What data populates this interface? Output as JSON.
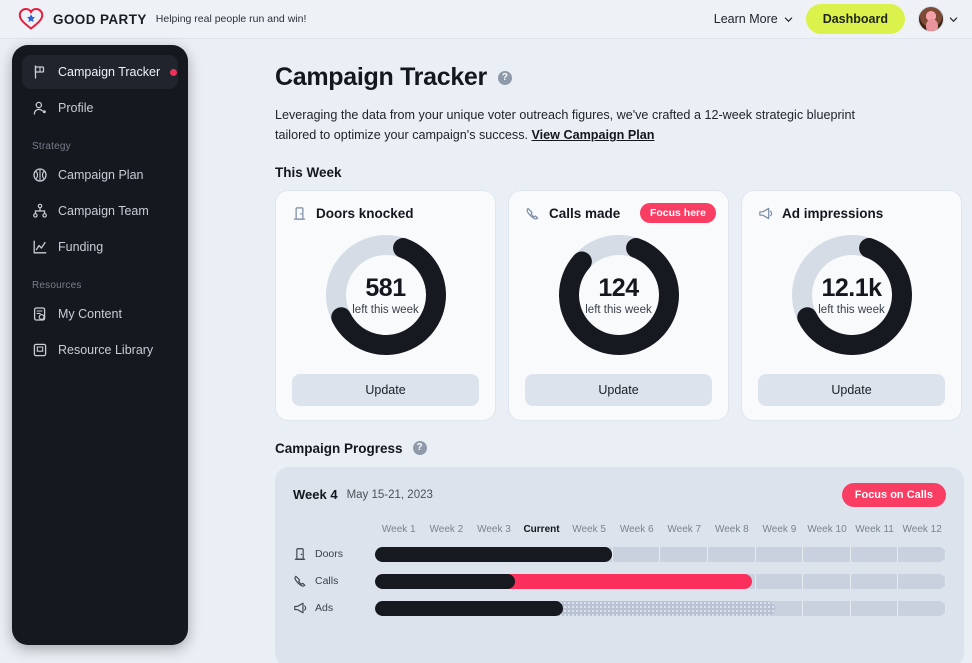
{
  "topbar": {
    "brand_name": "GOOD PARTY",
    "tagline": "Helping real people run and win!",
    "learn_more": "Learn More",
    "dashboard_button": "Dashboard"
  },
  "sidebar": {
    "items": [
      {
        "label": "Campaign Tracker",
        "icon": "flag-icon",
        "active": true,
        "dot": true
      },
      {
        "label": "Profile",
        "icon": "user-icon",
        "active": false,
        "dot": false
      }
    ],
    "sections": [
      {
        "title": "Strategy",
        "items": [
          {
            "label": "Campaign Plan",
            "icon": "brain-icon"
          },
          {
            "label": "Campaign Team",
            "icon": "team-icon"
          },
          {
            "label": "Funding",
            "icon": "chart-line-icon"
          }
        ]
      },
      {
        "title": "Resources",
        "items": [
          {
            "label": "My Content",
            "icon": "document-shield-icon"
          },
          {
            "label": "Resource Library",
            "icon": "book-icon"
          }
        ]
      }
    ]
  },
  "page": {
    "title": "Campaign Tracker",
    "help_glyph": "?",
    "description": "Leveraging the data from your unique voter outreach figures, we've crafted a 12-week strategic blueprint tailored to optimize your campaign's success.",
    "plan_link": "View Campaign Plan",
    "this_week_heading": "This Week"
  },
  "cards": [
    {
      "title": "Doors knocked",
      "icon": "door-icon",
      "value": "581",
      "sub": "left this week",
      "button": "Update",
      "badge": null,
      "percent": 62
    },
    {
      "title": "Calls made",
      "icon": "phone-icon",
      "value": "124",
      "sub": "left this week",
      "button": "Update",
      "badge": "Focus here",
      "percent": 81
    },
    {
      "title": "Ad impressions",
      "icon": "megaphone-icon",
      "value": "12.1k",
      "sub": "left this week",
      "button": "Update",
      "badge": null,
      "percent": 62
    }
  ],
  "progress": {
    "heading": "Campaign Progress",
    "help_glyph": "?",
    "week_number": "Week 4",
    "week_range": "May 15-21, 2023",
    "focus_button": "Focus on Calls",
    "week_labels": [
      "Week 1",
      "Week 2",
      "Week 3",
      "Current",
      "Week 5",
      "Week 6",
      "Week 7",
      "Week 8",
      "Week 9",
      "Week 10",
      "Week 11",
      "Week 12"
    ],
    "current_index": 3,
    "rows": [
      {
        "name": "Doors",
        "icon": "door-icon",
        "dark_pct": 41.5,
        "pink_pct": 0,
        "dots_pct": 0
      },
      {
        "name": "Calls",
        "icon": "phone-icon",
        "dark_pct": 24.5,
        "pink_pct": 41.5,
        "dots_pct": 0
      },
      {
        "name": "Ads",
        "icon": "megaphone-icon",
        "dark_pct": 33.0,
        "pink_pct": 0,
        "dots_pct": 37.0
      }
    ]
  },
  "colors": {
    "accent_pink": "#f93d63",
    "accent_lime": "#dcf24c",
    "dark": "#16191f",
    "panel": "#dde3ec",
    "page_bg": "#eaeff5"
  },
  "chart_data": [
    {
      "type": "pie",
      "title": "Doors knocked",
      "labels": [
        "completed",
        "remaining"
      ],
      "values": [
        62,
        38
      ],
      "center_value": "581",
      "center_label": "left this week"
    },
    {
      "type": "pie",
      "title": "Calls made",
      "labels": [
        "completed",
        "remaining"
      ],
      "values": [
        81,
        19
      ],
      "center_value": "124",
      "center_label": "left this week"
    },
    {
      "type": "pie",
      "title": "Ad impressions",
      "labels": [
        "completed",
        "remaining"
      ],
      "values": [
        62,
        38
      ],
      "center_value": "12.1k",
      "center_label": "left this week"
    },
    {
      "type": "bar",
      "title": "Campaign Progress",
      "categories": [
        "Week 1",
        "Week 2",
        "Week 3",
        "Current",
        "Week 5",
        "Week 6",
        "Week 7",
        "Week 8",
        "Week 9",
        "Week 10",
        "Week 11",
        "Week 12"
      ],
      "series": [
        {
          "name": "Doors",
          "values": [
            100,
            100,
            100,
            100,
            100,
            0,
            0,
            0,
            0,
            0,
            0,
            0
          ]
        },
        {
          "name": "Calls",
          "values": [
            100,
            100,
            100,
            45,
            100,
            0,
            0,
            0,
            0,
            0,
            0,
            0
          ]
        },
        {
          "name": "Ads",
          "values": [
            100,
            100,
            100,
            100,
            45,
            0,
            0,
            0,
            0,
            0,
            0,
            0
          ]
        }
      ],
      "xlabel": "",
      "ylabel": "",
      "ylim": [
        0,
        100
      ]
    }
  ]
}
